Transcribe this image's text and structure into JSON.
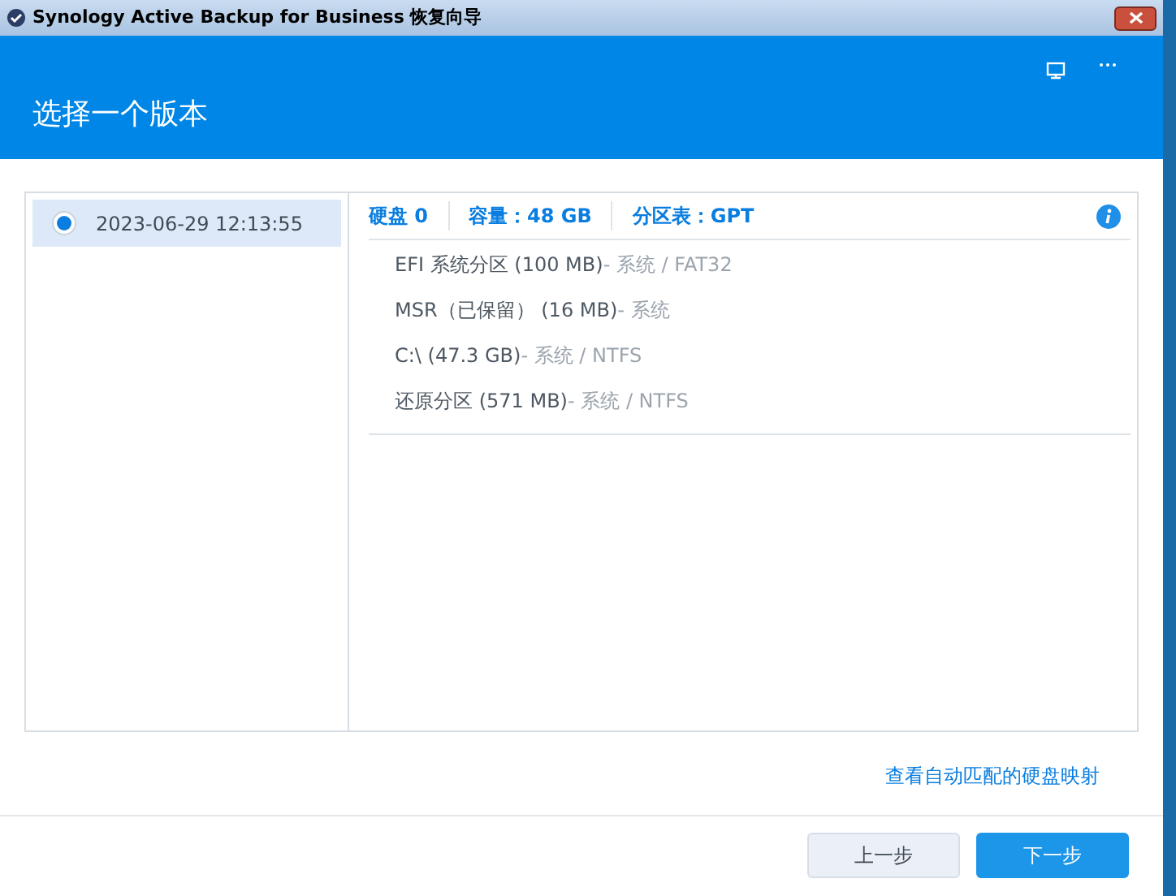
{
  "window": {
    "title": "Synology Active Backup for Business 恢复向导"
  },
  "header": {
    "title": "选择一个版本"
  },
  "versions": [
    {
      "label": "2023-06-29 12:13:55",
      "selected": true
    }
  ],
  "disk_info": [
    "硬盘 0",
    "容量：48 GB",
    "分区表：GPT"
  ],
  "partitions": [
    {
      "name": "EFI 系统分区 (100 MB)",
      "detail": "- 系统 / FAT32"
    },
    {
      "name": "MSR（已保留） (16 MB)",
      "detail": "- 系统"
    },
    {
      "name": "C:\\ (47.3 GB)",
      "detail": "- 系统 / NTFS"
    },
    {
      "name": "还原分区 (571 MB)",
      "detail": "- 系统 / NTFS"
    }
  ],
  "mapping_link": "查看自动匹配的硬盘映射",
  "buttons": [
    {
      "label": "上一步",
      "kind": "secondary"
    },
    {
      "label": "下一步",
      "kind": "primary"
    }
  ]
}
